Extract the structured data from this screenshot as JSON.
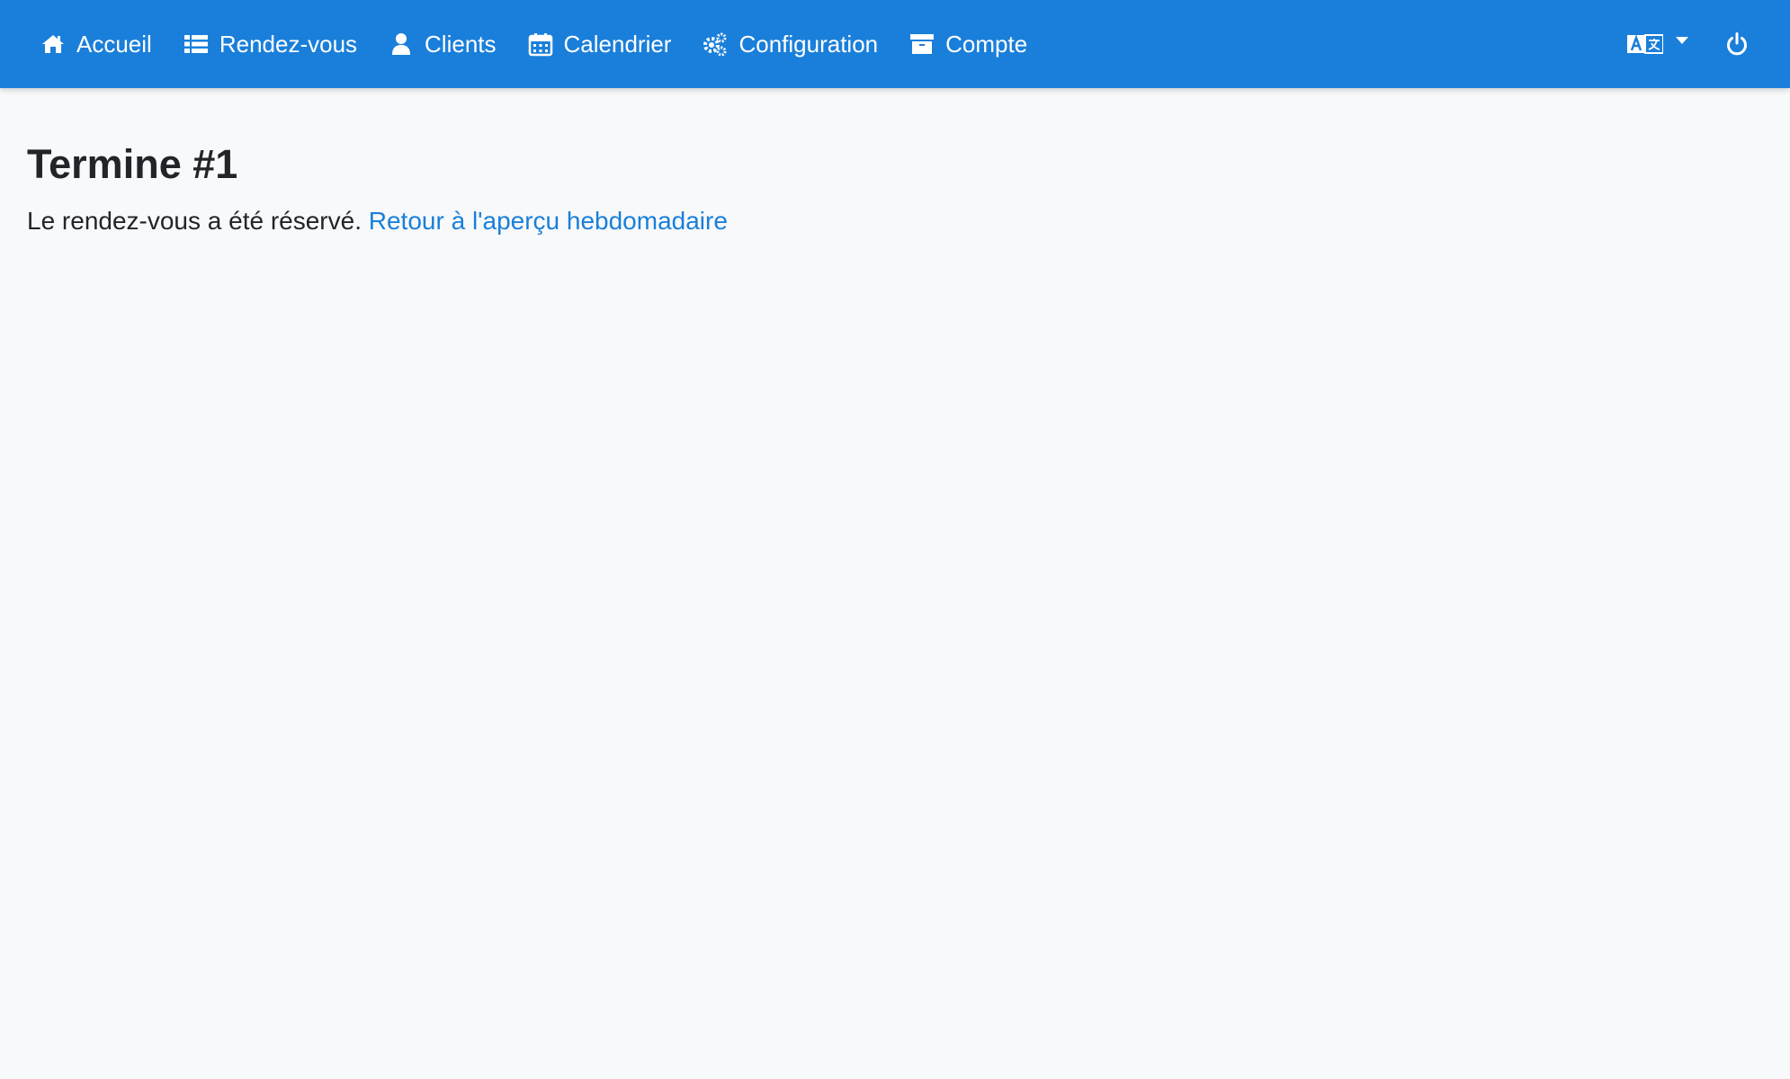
{
  "navbar": {
    "background_color": "#1a7fda",
    "items": [
      {
        "label": "Accueil",
        "icon": "home-icon"
      },
      {
        "label": "Rendez-vous",
        "icon": "list-icon"
      },
      {
        "label": "Clients",
        "icon": "user-icon"
      },
      {
        "label": "Calendrier",
        "icon": "calendar-icon"
      },
      {
        "label": "Configuration",
        "icon": "cogs-icon"
      },
      {
        "label": "Compte",
        "icon": "archive-icon"
      }
    ],
    "language_icon": "language-icon",
    "logout_icon": "power-icon"
  },
  "main": {
    "title": "Termine #1",
    "message": "Le rendez-vous a été réservé.",
    "back_link": "Retour à l'aperçu hebdomadaire",
    "link_color": "#1a7fda"
  }
}
